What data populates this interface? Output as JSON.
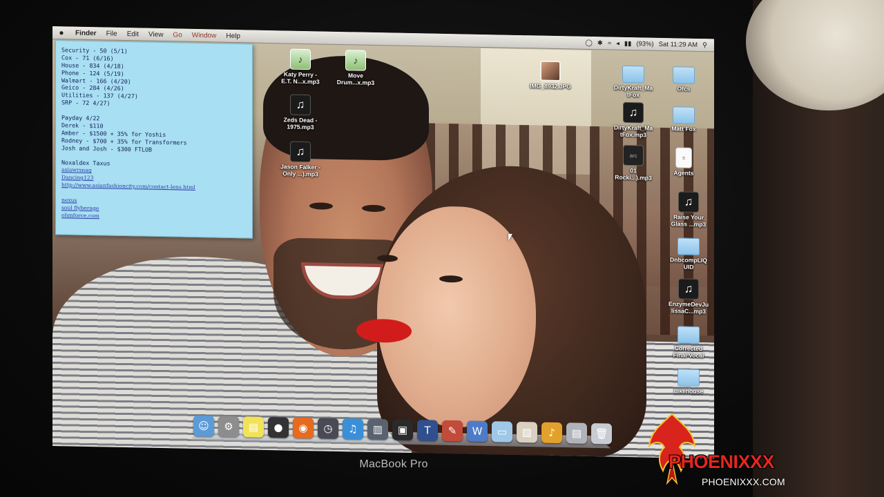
{
  "menubar": {
    "apple_icon": "apple-icon",
    "menus": [
      "Finder",
      "File",
      "Edit",
      "View",
      "Go",
      "Window",
      "Help"
    ],
    "status": {
      "battery": "(93%)",
      "clock": "Sat 11:29 AM"
    }
  },
  "note": {
    "lines": [
      {
        "text": "Security - 50 (5/1)",
        "type": "text"
      },
      {
        "text": "Cox - 71 (6/16)",
        "type": "text"
      },
      {
        "text": "House - 834 (4/18)",
        "type": "text"
      },
      {
        "text": "Phone - 124 (5/19)",
        "type": "text"
      },
      {
        "text": "Walmart - 166 (4/20)",
        "type": "text"
      },
      {
        "text": "Geico - 284 (4/26)",
        "type": "text"
      },
      {
        "text": "Utilities - 137 (4/27)",
        "type": "text"
      },
      {
        "text": "SRP - 72 4/27)",
        "type": "text"
      },
      {
        "text": "",
        "type": "gap"
      },
      {
        "text": "Payday 4/22",
        "type": "text"
      },
      {
        "text": "Derek - $110",
        "type": "text"
      },
      {
        "text": "Amber - $1500 + 35% for Yoshis",
        "type": "text"
      },
      {
        "text": "Rodney - $700 + 35% for Transformers",
        "type": "text"
      },
      {
        "text": "Josh and Josh - $300 FTLOB",
        "type": "text"
      },
      {
        "text": "",
        "type": "gap"
      },
      {
        "text": "Noxaldex Taxus",
        "type": "text"
      },
      {
        "text": "asiawrsnag",
        "type": "link"
      },
      {
        "text": "Dancing123",
        "type": "link"
      },
      {
        "text": "http://www.asianfashioncity.com/contact-lens.html",
        "type": "link"
      },
      {
        "text": "",
        "type": "gap"
      },
      {
        "text": "nexus",
        "type": "link"
      },
      {
        "text": "soul flyberage",
        "type": "link"
      },
      {
        "text": "ohmforce.com",
        "type": "link"
      }
    ]
  },
  "desktop_icons": [
    {
      "label": "Katy Perry -\nE.T. N...x.mp3",
      "kind": "app",
      "icon": "audio-file-icon"
    },
    {
      "label": "Move\nDrum...x.mp3",
      "kind": "app",
      "icon": "audio-file-icon"
    },
    {
      "label": "Zeds Dead -\n1975.mp3",
      "kind": "music",
      "icon": "music-note-icon"
    },
    {
      "label": "Jason Falker -\nOnly ...).mp3",
      "kind": "music",
      "icon": "music-note-icon"
    },
    {
      "label": "IMG_8932.JPG",
      "kind": "img",
      "icon": "image-file-icon"
    },
    {
      "label": "DirtyKraft_Ma\ntFox",
      "kind": "folder",
      "icon": "folder-icon"
    },
    {
      "label": "Ofcs",
      "kind": "folder",
      "icon": "folder-icon"
    },
    {
      "label": "DirtyKraft_Ma\ntFox.mp3",
      "kind": "music",
      "icon": "music-note-icon"
    },
    {
      "label": "Matt Fox",
      "kind": "folder",
      "icon": "folder-icon"
    },
    {
      "label": "01\nRocki...).mp3",
      "kind": "album",
      "icon": "album-art-icon"
    },
    {
      "label": "Agents",
      "kind": "doc",
      "icon": "document-icon"
    },
    {
      "label": "Raise Your\nGlass ...mp3",
      "kind": "music",
      "icon": "music-note-icon"
    },
    {
      "label": "DnbcompLIQ\nUID",
      "kind": "folder",
      "icon": "folder-icon"
    },
    {
      "label": "EnzymeDevJu\nlissaC...mp3",
      "kind": "music",
      "icon": "music-note-icon"
    },
    {
      "label": "Corrected\nFinal Vocal",
      "kind": "folder",
      "icon": "folder-icon"
    },
    {
      "label": "Likehouse",
      "kind": "folder",
      "icon": "folder-icon"
    }
  ],
  "dock": [
    {
      "name": "finder",
      "icon": "finder-icon",
      "color": "#5b9bd8",
      "glyph": "☺"
    },
    {
      "name": "system-preferences",
      "icon": "gear-icon",
      "color": "#8d8d8d",
      "glyph": "⚙"
    },
    {
      "name": "stickies",
      "icon": "stickies-icon",
      "color": "#f2e25a",
      "glyph": "▤"
    },
    {
      "name": "logic",
      "icon": "record-icon",
      "color": "#333333",
      "glyph": "●"
    },
    {
      "name": "firefox",
      "icon": "firefox-icon",
      "color": "#e66a1f",
      "glyph": "◉"
    },
    {
      "name": "time-machine",
      "icon": "clock-icon",
      "color": "#4a4a55",
      "glyph": "◷"
    },
    {
      "name": "itunes",
      "icon": "music-note-icon",
      "color": "#3a8fd9",
      "glyph": "♫"
    },
    {
      "name": "audio-app",
      "icon": "waveform-icon",
      "color": "#5a6270",
      "glyph": "▥"
    },
    {
      "name": "final-cut",
      "icon": "clapper-icon",
      "color": "#2a2a2a",
      "glyph": "▣"
    },
    {
      "name": "textedit",
      "icon": "text-icon",
      "color": "#2f4f8f",
      "glyph": "T"
    },
    {
      "name": "script-editor",
      "icon": "scroll-icon",
      "color": "#c24b3a",
      "glyph": "✎"
    },
    {
      "name": "ableton",
      "icon": "waveform-icon",
      "color": "#4d7bc7",
      "glyph": "W"
    },
    {
      "name": "documents-folder",
      "icon": "folder-icon",
      "color": "#9fc8e8",
      "glyph": "▭"
    },
    {
      "name": "preview",
      "icon": "photo-icon",
      "color": "#d8d0c0",
      "glyph": "▨"
    },
    {
      "name": "garageband",
      "icon": "guitar-icon",
      "color": "#e2a12a",
      "glyph": "♪"
    },
    {
      "name": "downloads",
      "icon": "downloads-icon",
      "color": "#b0b4ba",
      "glyph": "▤"
    },
    {
      "name": "trash",
      "icon": "trash-icon",
      "color": "#c8ccd2",
      "glyph": "🗑"
    }
  ],
  "bezel_brand": "MacBook Pro",
  "watermark": {
    "name": "PHOENIXXX",
    "site": "PHOENIXXX.COM",
    "colors": {
      "red": "#e3271f",
      "white": "#ffffff"
    }
  }
}
